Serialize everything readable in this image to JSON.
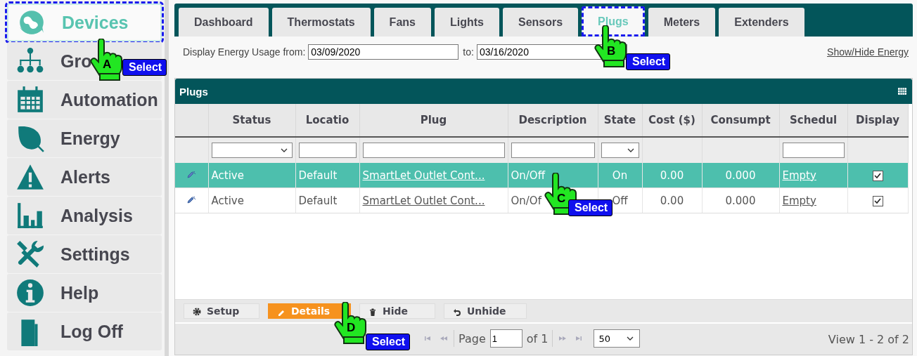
{
  "sidebar": {
    "items": [
      {
        "label": "Devices",
        "selected": true
      },
      {
        "label": "Gro",
        "selected": false
      },
      {
        "label": "Automation",
        "selected": false
      },
      {
        "label": "Energy",
        "selected": false
      },
      {
        "label": "Alerts",
        "selected": false
      },
      {
        "label": "Analysis",
        "selected": false
      },
      {
        "label": "Settings",
        "selected": false
      },
      {
        "label": "Help",
        "selected": false
      },
      {
        "label": "Log Off",
        "selected": false
      }
    ]
  },
  "tabs": [
    {
      "label": "Dashboard",
      "selected": false
    },
    {
      "label": "Thermostats",
      "selected": false
    },
    {
      "label": "Fans",
      "selected": false
    },
    {
      "label": "Lights",
      "selected": false
    },
    {
      "label": "Sensors",
      "selected": false
    },
    {
      "label": "Plugs",
      "selected": true
    },
    {
      "label": "Meters",
      "selected": false
    },
    {
      "label": "Extenders",
      "selected": false
    }
  ],
  "energy_filter": {
    "from_label": "Display Energy Usage from:",
    "from_value": "03/09/2020",
    "to_label": "to:",
    "to_value": "03/16/2020",
    "link": "Show/Hide Energy"
  },
  "grid": {
    "title": "Plugs",
    "columns": [
      {
        "kind": "blank"
      },
      {
        "label": "Status",
        "kind": "select"
      },
      {
        "label": "Locatio",
        "kind": "text"
      },
      {
        "label": "Plug",
        "kind": "text"
      },
      {
        "label": "Description",
        "kind": "text"
      },
      {
        "label": "State",
        "kind": "select"
      },
      {
        "label": "Cost ($)",
        "kind": "blank"
      },
      {
        "label": "Consumpt",
        "kind": "blank"
      },
      {
        "label": "Schedul",
        "kind": "text"
      },
      {
        "label": "Display",
        "kind": "blank"
      }
    ],
    "rows": [
      {
        "selected": true,
        "status": "Active",
        "location": "Default",
        "plug": "SmartLet Outlet Cont...",
        "description": "On/Off",
        "state": "On",
        "cost": "0.00",
        "consumption": "0.000",
        "schedule": "Empty",
        "display": true
      },
      {
        "selected": false,
        "status": "Active",
        "location": "Default",
        "plug": "SmartLet Outlet Cont...",
        "description": "On/Of",
        "state": "Off",
        "cost": "0.00",
        "consumption": "0.000",
        "schedule": "Empty",
        "display": true
      }
    ],
    "toolbar": [
      {
        "label": "Setup",
        "highlighted": false
      },
      {
        "label": "Details",
        "highlighted": true
      },
      {
        "label": "Hide",
        "highlighted": false
      },
      {
        "label": "Unhide",
        "highlighted": false
      }
    ],
    "pager": {
      "page_label": "Page",
      "page": "1",
      "of": "of 1",
      "page_size": "50",
      "summary": "View 1 - 2 of 2"
    }
  },
  "callouts": [
    {
      "letter": "A",
      "label": "Select"
    },
    {
      "letter": "B",
      "label": "Select"
    },
    {
      "letter": "C",
      "label": "Select"
    },
    {
      "letter": "D",
      "label": "Select"
    }
  ]
}
